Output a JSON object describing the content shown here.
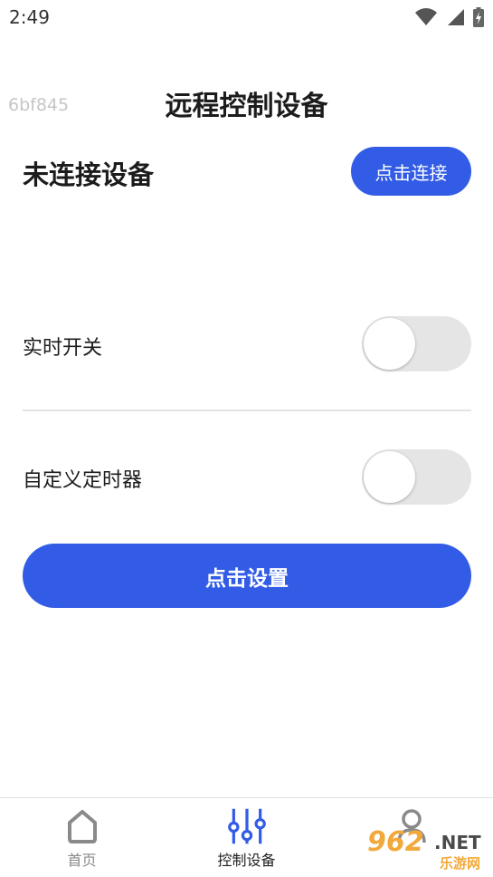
{
  "status_bar": {
    "time": "2:49",
    "icons": [
      "wifi-icon",
      "signal-icon",
      "battery-icon"
    ]
  },
  "header": {
    "device_id": "6bf845",
    "title": "远程控制设备"
  },
  "connection": {
    "status_text": "未连接设备",
    "connect_button_label": "点击连接"
  },
  "settings": {
    "realtime_switch_label": "实时开关",
    "realtime_switch_on": false,
    "custom_timer_label": "自定义定时器",
    "custom_timer_on": false
  },
  "actions": {
    "set_button_label": "点击设置"
  },
  "bottom_nav": {
    "items": [
      {
        "label": "首页",
        "icon": "home-icon",
        "active": false
      },
      {
        "label": "控制设备",
        "icon": "sliders-icon",
        "active": true
      },
      {
        "label": "",
        "icon": "user-icon",
        "active": false
      }
    ]
  },
  "watermark": {
    "number": "962",
    "suffix": ".NET",
    "cn": "乐游网"
  },
  "colors": {
    "accent": "#335ce6",
    "toggle_off": "#e5e5e5",
    "watermark_orange": "#f2a93b"
  }
}
